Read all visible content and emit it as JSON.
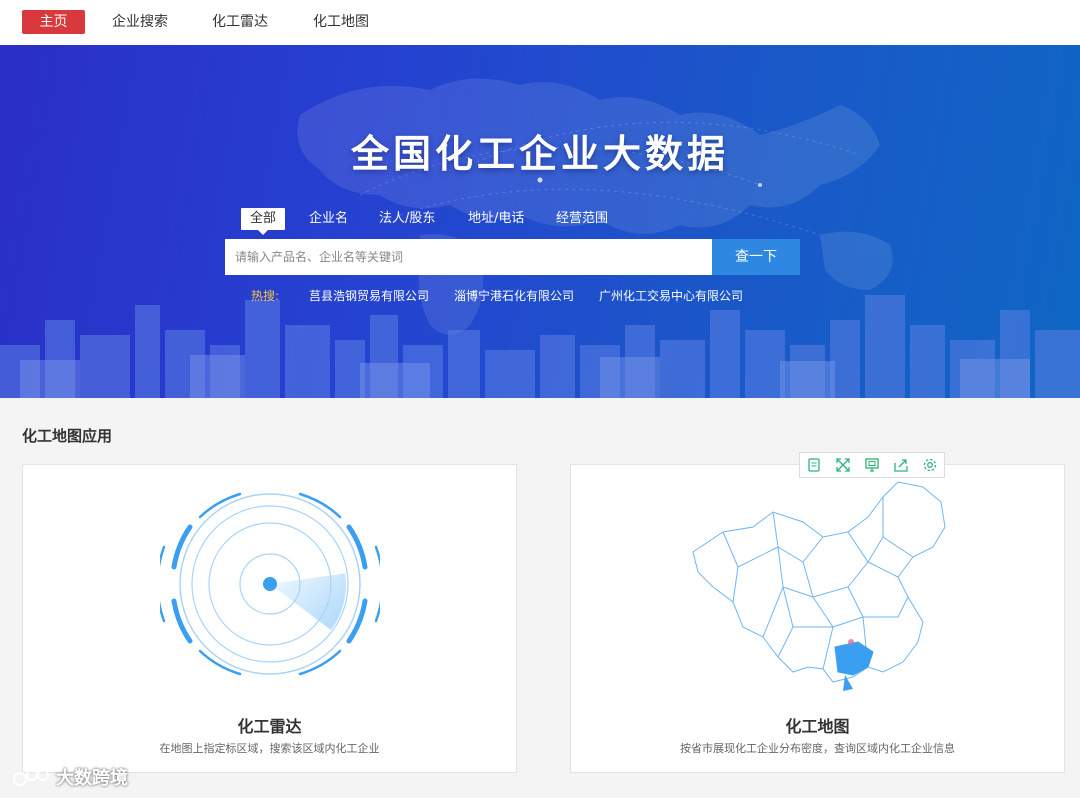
{
  "nav": {
    "items": [
      {
        "label": "主页",
        "active": true
      },
      {
        "label": "企业搜索",
        "active": false
      },
      {
        "label": "化工雷达",
        "active": false
      },
      {
        "label": "化工地图",
        "active": false
      }
    ]
  },
  "hero": {
    "title": "全国化工企业大数据",
    "tabs": [
      {
        "label": "全部",
        "active": true
      },
      {
        "label": "企业名",
        "active": false
      },
      {
        "label": "法人/股东",
        "active": false
      },
      {
        "label": "地址/电话",
        "active": false
      },
      {
        "label": "经营范围",
        "active": false
      }
    ],
    "search": {
      "placeholder": "请输入产品名、企业名等关键词",
      "value": "",
      "button": "查一下"
    },
    "hot": {
      "label": "热搜:",
      "links": [
        "莒县浩钢贸易有限公司",
        "淄博宁港石化有限公司",
        "广州化工交易中心有限公司"
      ]
    }
  },
  "section": {
    "title": "化工地图应用",
    "cards": [
      {
        "title": "化工雷达",
        "desc": "在地图上指定标区域，搜索该区域内化工企业",
        "icon": "radar-icon"
      },
      {
        "title": "化工地图",
        "desc": "按省市展现化工企业分布密度，查询区域内化工企业信息",
        "icon": "china-map-icon"
      }
    ]
  },
  "map_toolbar": {
    "tools": [
      "data-view-icon",
      "zoom-icon",
      "restore-icon",
      "export-icon",
      "settings-icon"
    ]
  },
  "watermark": {
    "text": "大数跨境"
  },
  "colors": {
    "accent_red": "#d9393d",
    "button_blue": "#2e87e0",
    "hot_yellow": "#f6c544",
    "radar_blue": "#3a9ff0",
    "map_outline": "#6fb6f2"
  }
}
